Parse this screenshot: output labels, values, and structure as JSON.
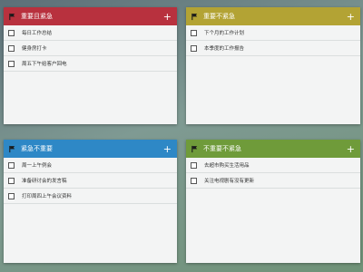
{
  "quadrants": [
    {
      "title": "重要且紧急",
      "color": "#b8313e",
      "add_label": "+",
      "tasks": [
        "每日工作总结",
        "健身房打卡",
        "周五下午给客户回电"
      ]
    },
    {
      "title": "重要不紧急",
      "color": "#b3a334",
      "add_label": "+",
      "tasks": [
        "下个月的工作计划",
        "本季度的工作报告"
      ]
    },
    {
      "title": "紧急不重要",
      "color": "#2e88c6",
      "add_label": "+",
      "tasks": [
        "周一上午例会",
        "准备研讨会的发言稿",
        "打印周四上午会议资料"
      ]
    },
    {
      "title": "不重要不紧急",
      "color": "#6f9b3a",
      "add_label": "+",
      "tasks": [
        "去超市购买生活用品",
        "关注电视剧有没有更新"
      ]
    }
  ],
  "icons": {
    "flag": "flag-icon",
    "add": "plus-icon",
    "checkbox": "checkbox"
  }
}
